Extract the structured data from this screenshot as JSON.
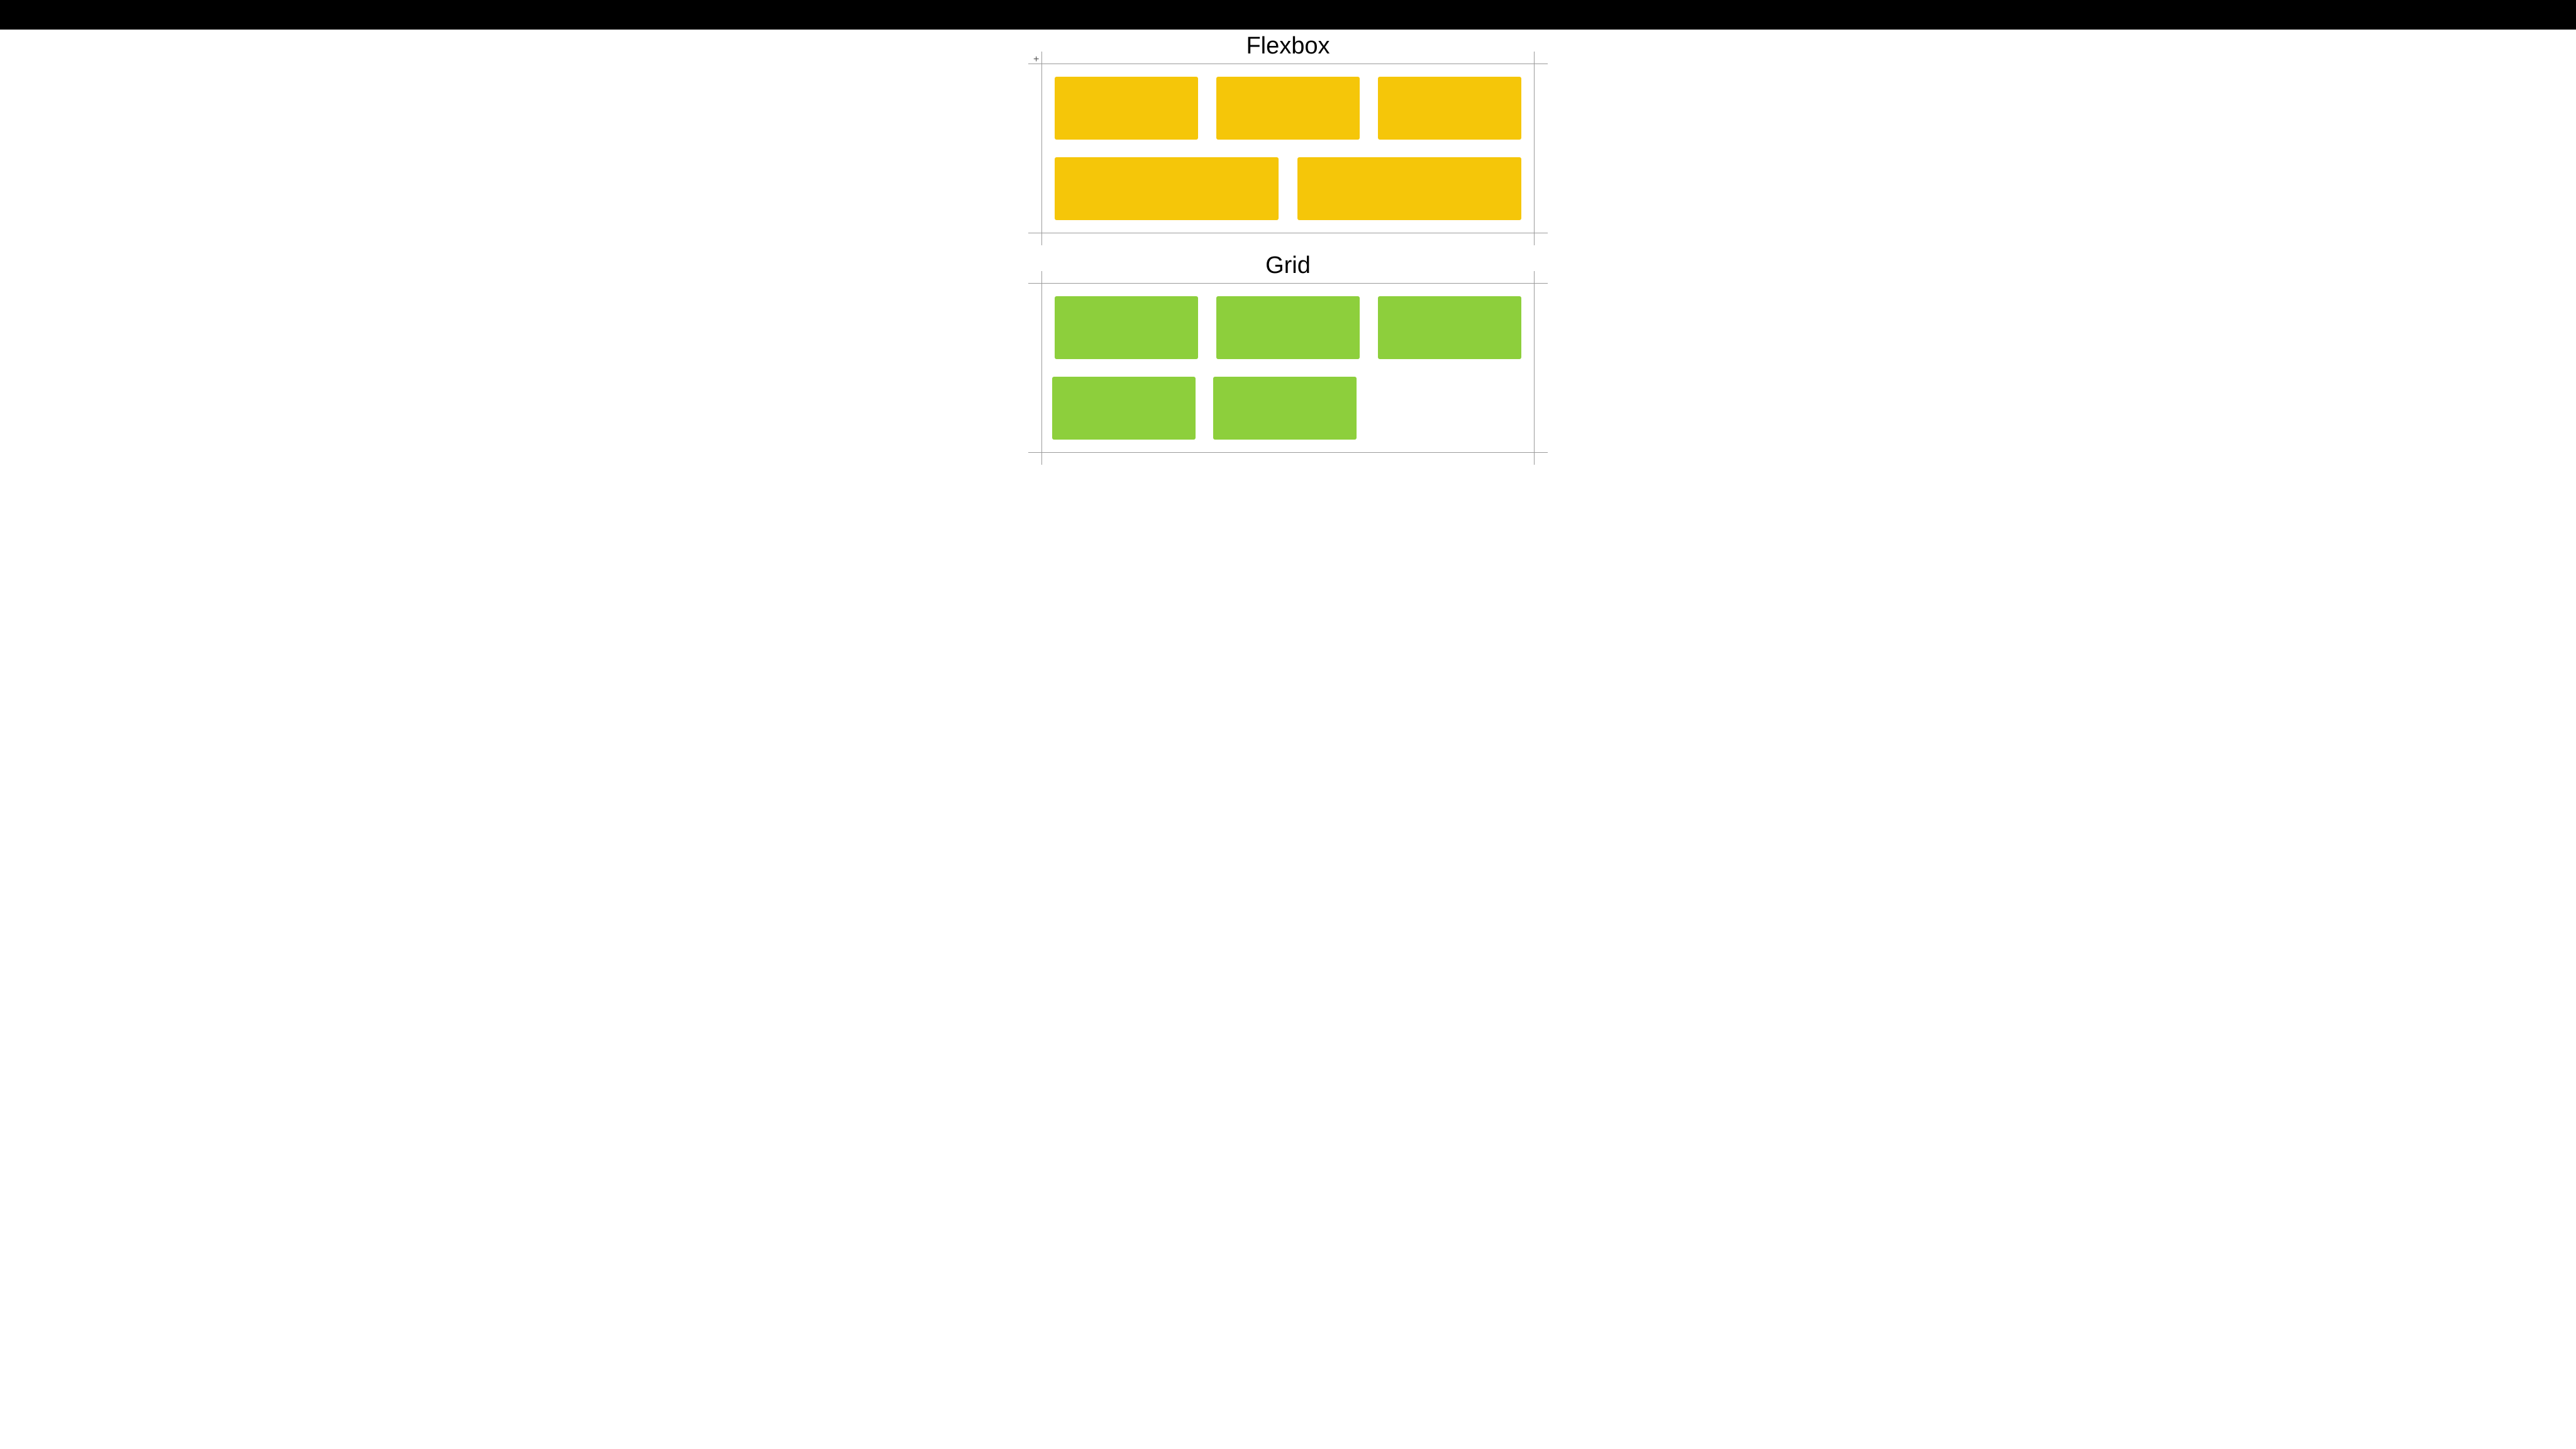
{
  "flexbox": {
    "title": "Flexbox",
    "color": "#f5c609",
    "items_row1": 3,
    "items_row2": 2,
    "row2_fills_width": true
  },
  "grid": {
    "title": "Grid",
    "color": "#8dcf3c",
    "columns": 3,
    "items_row1": 3,
    "items_row2": 2,
    "row2_fills_width": false
  }
}
